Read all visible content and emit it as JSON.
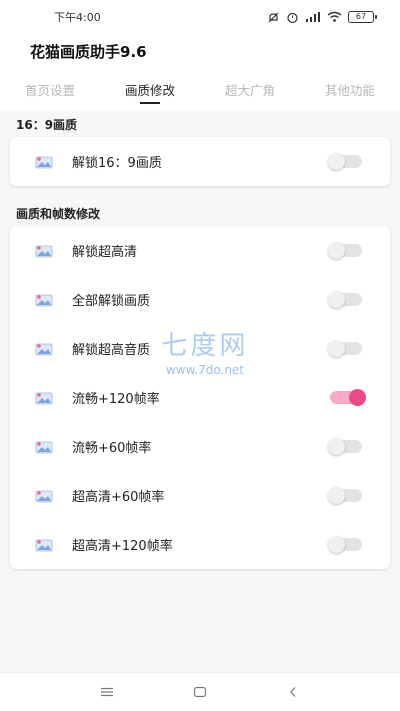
{
  "status_bar": {
    "time": "下午4:00",
    "battery": "67"
  },
  "app": {
    "title": "花猫画质助手9.6"
  },
  "tabs": [
    {
      "label": "首页设置",
      "active": false
    },
    {
      "label": "画质修改",
      "active": true
    },
    {
      "label": "超大广角",
      "active": false
    },
    {
      "label": "其他功能",
      "active": false
    }
  ],
  "section_aspect": {
    "title": "16：9画质",
    "items": [
      {
        "label": "解锁16：9画质",
        "on": false
      }
    ]
  },
  "section_quality": {
    "title": "画质和帧数修改",
    "items": [
      {
        "label": "解锁超高清",
        "on": false
      },
      {
        "label": "全部解锁画质",
        "on": false
      },
      {
        "label": "解锁超高音质",
        "on": false
      },
      {
        "label": "流畅+120帧率",
        "on": true
      },
      {
        "label": "流畅+60帧率",
        "on": false
      },
      {
        "label": "超高清+60帧率",
        "on": false
      },
      {
        "label": "超高清+120帧率",
        "on": false
      }
    ]
  },
  "watermark": {
    "text": "七度网",
    "url": "www.7do.net"
  },
  "colors": {
    "toggle_on_knob": "#ea4c89",
    "toggle_on_track": "#f8a9c7",
    "toggle_off_track": "#e3e3e3"
  },
  "icons": {
    "row_icon": "image-card-icon",
    "nav": [
      "menu-icon",
      "home-icon",
      "back-icon"
    ]
  }
}
